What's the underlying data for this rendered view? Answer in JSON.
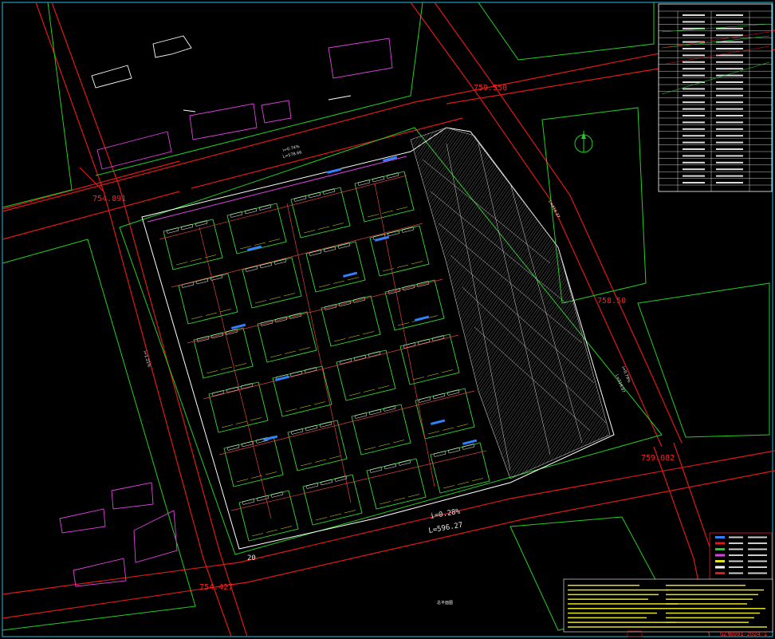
{
  "colors": {
    "background": "#000000",
    "road": "#e01818",
    "boundary": "#20d020",
    "building_white": "#ffffff",
    "building_magenta": "#e040e0",
    "frame": "#20c0e0",
    "hatch": "#9a9a9a",
    "blue_text": "#3080ff",
    "yellow_text": "#e0e020"
  },
  "icons": [
    "north-arrow-icon"
  ],
  "elevations": {
    "top_center": "759.550",
    "top_left": "754.891",
    "right_mid": "758.50",
    "right_lower": "759.082",
    "bottom_left": "754.427"
  },
  "dimensions": {
    "slope_bottom": "i=0.28%",
    "length_bottom": "L=596.27",
    "road_width": "20",
    "top_road_slope": "i=0.74%",
    "top_road_length": "L=578.66",
    "left_road_slope": "i=1.21%",
    "right_road_slope": "i=0.79%",
    "right_road_length": "L=516.07",
    "diag_road_length": "L=416.37"
  },
  "stamp": "GZ-0001-2024-1",
  "drawing_label": "总平面图"
}
